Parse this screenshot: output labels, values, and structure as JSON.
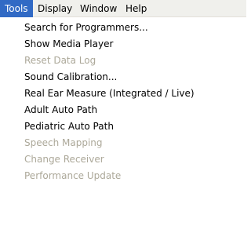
{
  "menubar": {
    "items": [
      {
        "label": "Tools",
        "active": true
      },
      {
        "label": "Display",
        "active": false
      },
      {
        "label": "Window",
        "active": false
      },
      {
        "label": "Help",
        "active": false
      }
    ]
  },
  "tools_menu": {
    "items": [
      {
        "label": "Search for Programmers...",
        "enabled": true
      },
      {
        "label": "Show Media Player",
        "enabled": true
      },
      {
        "label": "Reset Data Log",
        "enabled": false
      },
      {
        "label": "Sound Calibration...",
        "enabled": true
      },
      {
        "label": "Real Ear Measure (Integrated / Live)",
        "enabled": true
      },
      {
        "label": "Adult Auto Path",
        "enabled": true
      },
      {
        "label": "Pediatric Auto Path",
        "enabled": true
      },
      {
        "label": "Speech Mapping",
        "enabled": false
      },
      {
        "label": "Change Receiver",
        "enabled": false
      },
      {
        "label": "Performance Update",
        "enabled": false
      }
    ]
  },
  "colors": {
    "menubar_bg": "#f0f0ec",
    "highlight_bg": "#316ac5",
    "highlight_text": "#ffffff",
    "disabled_text": "#aca899",
    "menu_bg": "#ffffff"
  }
}
